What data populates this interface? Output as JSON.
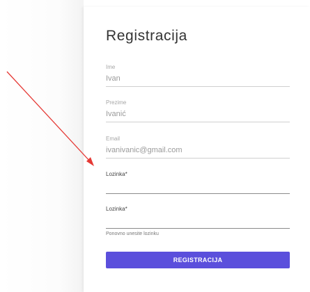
{
  "form": {
    "title": "Registracija",
    "fields": [
      {
        "label": "Ime",
        "value": "Ivan"
      },
      {
        "label": "Prezime",
        "value": "Ivanić"
      },
      {
        "label": "Email",
        "value": "ivanivanic@gmail.com"
      },
      {
        "label": "Lozinka*",
        "value": ""
      },
      {
        "label": "Lozinka*",
        "value": ""
      }
    ],
    "hint": "Ponovno unesite lozinku",
    "submit_label": "REGISTRACIJA"
  },
  "colors": {
    "accent": "#5b4fdc",
    "annotation_arrow": "#e53935"
  }
}
